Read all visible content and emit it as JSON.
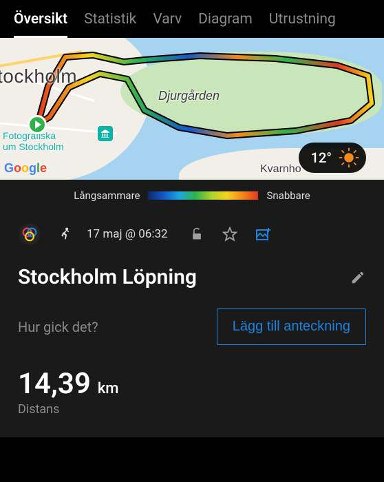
{
  "tabs": {
    "overview": "Översikt",
    "stats": "Statistik",
    "laps": "Varv",
    "chart": "Diagram",
    "gear": "Utrustning"
  },
  "map": {
    "city_label": "tockholm",
    "park_label": "Djurgården",
    "town_label": "Kvarnho",
    "poi1_line1": "Fotografiska",
    "poi1_line2": "um Stockholm",
    "google": {
      "g": "G",
      "o1": "o",
      "o2": "o",
      "g2": "g",
      "l": "l",
      "e": "e"
    },
    "weather_temp": "12°"
  },
  "legend": {
    "slower": "Långsammare",
    "faster": "Snabbare"
  },
  "activity": {
    "date": "17 maj @ 06:32",
    "title": "Stockholm Löpning",
    "prompt": "Hur gick det?",
    "add_note": "Lägg till anteckning",
    "distance_value": "14,39",
    "distance_unit": "km",
    "distance_label": "Distans"
  }
}
